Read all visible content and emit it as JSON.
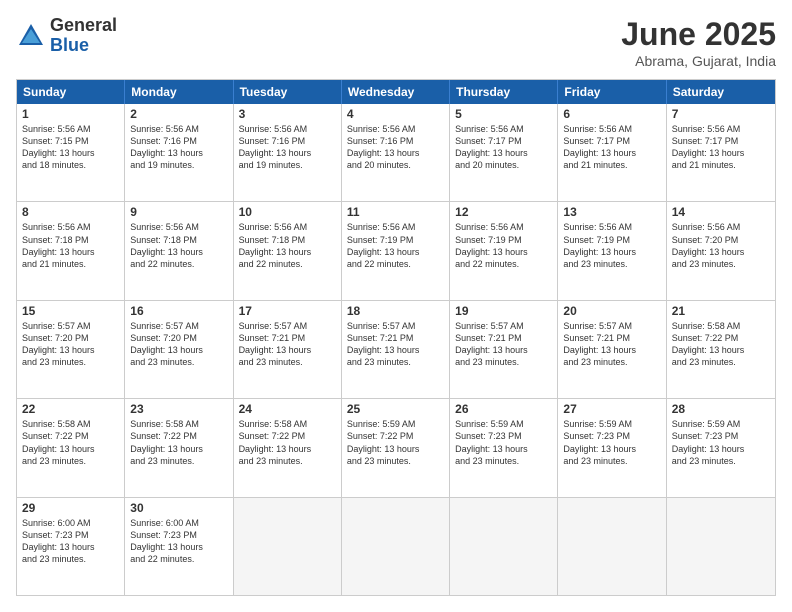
{
  "logo": {
    "general": "General",
    "blue": "Blue"
  },
  "title": "June 2025",
  "location": "Abrama, Gujarat, India",
  "header_days": [
    "Sunday",
    "Monday",
    "Tuesday",
    "Wednesday",
    "Thursday",
    "Friday",
    "Saturday"
  ],
  "weeks": [
    [
      {
        "day": "1",
        "lines": [
          "Sunrise: 5:56 AM",
          "Sunset: 7:15 PM",
          "Daylight: 13 hours",
          "and 18 minutes."
        ]
      },
      {
        "day": "2",
        "lines": [
          "Sunrise: 5:56 AM",
          "Sunset: 7:16 PM",
          "Daylight: 13 hours",
          "and 19 minutes."
        ]
      },
      {
        "day": "3",
        "lines": [
          "Sunrise: 5:56 AM",
          "Sunset: 7:16 PM",
          "Daylight: 13 hours",
          "and 19 minutes."
        ]
      },
      {
        "day": "4",
        "lines": [
          "Sunrise: 5:56 AM",
          "Sunset: 7:16 PM",
          "Daylight: 13 hours",
          "and 20 minutes."
        ]
      },
      {
        "day": "5",
        "lines": [
          "Sunrise: 5:56 AM",
          "Sunset: 7:17 PM",
          "Daylight: 13 hours",
          "and 20 minutes."
        ]
      },
      {
        "day": "6",
        "lines": [
          "Sunrise: 5:56 AM",
          "Sunset: 7:17 PM",
          "Daylight: 13 hours",
          "and 21 minutes."
        ]
      },
      {
        "day": "7",
        "lines": [
          "Sunrise: 5:56 AM",
          "Sunset: 7:17 PM",
          "Daylight: 13 hours",
          "and 21 minutes."
        ]
      }
    ],
    [
      {
        "day": "8",
        "lines": [
          "Sunrise: 5:56 AM",
          "Sunset: 7:18 PM",
          "Daylight: 13 hours",
          "and 21 minutes."
        ]
      },
      {
        "day": "9",
        "lines": [
          "Sunrise: 5:56 AM",
          "Sunset: 7:18 PM",
          "Daylight: 13 hours",
          "and 22 minutes."
        ]
      },
      {
        "day": "10",
        "lines": [
          "Sunrise: 5:56 AM",
          "Sunset: 7:18 PM",
          "Daylight: 13 hours",
          "and 22 minutes."
        ]
      },
      {
        "day": "11",
        "lines": [
          "Sunrise: 5:56 AM",
          "Sunset: 7:19 PM",
          "Daylight: 13 hours",
          "and 22 minutes."
        ]
      },
      {
        "day": "12",
        "lines": [
          "Sunrise: 5:56 AM",
          "Sunset: 7:19 PM",
          "Daylight: 13 hours",
          "and 22 minutes."
        ]
      },
      {
        "day": "13",
        "lines": [
          "Sunrise: 5:56 AM",
          "Sunset: 7:19 PM",
          "Daylight: 13 hours",
          "and 23 minutes."
        ]
      },
      {
        "day": "14",
        "lines": [
          "Sunrise: 5:56 AM",
          "Sunset: 7:20 PM",
          "Daylight: 13 hours",
          "and 23 minutes."
        ]
      }
    ],
    [
      {
        "day": "15",
        "lines": [
          "Sunrise: 5:57 AM",
          "Sunset: 7:20 PM",
          "Daylight: 13 hours",
          "and 23 minutes."
        ]
      },
      {
        "day": "16",
        "lines": [
          "Sunrise: 5:57 AM",
          "Sunset: 7:20 PM",
          "Daylight: 13 hours",
          "and 23 minutes."
        ]
      },
      {
        "day": "17",
        "lines": [
          "Sunrise: 5:57 AM",
          "Sunset: 7:21 PM",
          "Daylight: 13 hours",
          "and 23 minutes."
        ]
      },
      {
        "day": "18",
        "lines": [
          "Sunrise: 5:57 AM",
          "Sunset: 7:21 PM",
          "Daylight: 13 hours",
          "and 23 minutes."
        ]
      },
      {
        "day": "19",
        "lines": [
          "Sunrise: 5:57 AM",
          "Sunset: 7:21 PM",
          "Daylight: 13 hours",
          "and 23 minutes."
        ]
      },
      {
        "day": "20",
        "lines": [
          "Sunrise: 5:57 AM",
          "Sunset: 7:21 PM",
          "Daylight: 13 hours",
          "and 23 minutes."
        ]
      },
      {
        "day": "21",
        "lines": [
          "Sunrise: 5:58 AM",
          "Sunset: 7:22 PM",
          "Daylight: 13 hours",
          "and 23 minutes."
        ]
      }
    ],
    [
      {
        "day": "22",
        "lines": [
          "Sunrise: 5:58 AM",
          "Sunset: 7:22 PM",
          "Daylight: 13 hours",
          "and 23 minutes."
        ]
      },
      {
        "day": "23",
        "lines": [
          "Sunrise: 5:58 AM",
          "Sunset: 7:22 PM",
          "Daylight: 13 hours",
          "and 23 minutes."
        ]
      },
      {
        "day": "24",
        "lines": [
          "Sunrise: 5:58 AM",
          "Sunset: 7:22 PM",
          "Daylight: 13 hours",
          "and 23 minutes."
        ]
      },
      {
        "day": "25",
        "lines": [
          "Sunrise: 5:59 AM",
          "Sunset: 7:22 PM",
          "Daylight: 13 hours",
          "and 23 minutes."
        ]
      },
      {
        "day": "26",
        "lines": [
          "Sunrise: 5:59 AM",
          "Sunset: 7:23 PM",
          "Daylight: 13 hours",
          "and 23 minutes."
        ]
      },
      {
        "day": "27",
        "lines": [
          "Sunrise: 5:59 AM",
          "Sunset: 7:23 PM",
          "Daylight: 13 hours",
          "and 23 minutes."
        ]
      },
      {
        "day": "28",
        "lines": [
          "Sunrise: 5:59 AM",
          "Sunset: 7:23 PM",
          "Daylight: 13 hours",
          "and 23 minutes."
        ]
      }
    ],
    [
      {
        "day": "29",
        "lines": [
          "Sunrise: 6:00 AM",
          "Sunset: 7:23 PM",
          "Daylight: 13 hours",
          "and 23 minutes."
        ]
      },
      {
        "day": "30",
        "lines": [
          "Sunrise: 6:00 AM",
          "Sunset: 7:23 PM",
          "Daylight: 13 hours",
          "and 22 minutes."
        ]
      },
      {
        "day": "",
        "lines": []
      },
      {
        "day": "",
        "lines": []
      },
      {
        "day": "",
        "lines": []
      },
      {
        "day": "",
        "lines": []
      },
      {
        "day": "",
        "lines": []
      }
    ]
  ]
}
